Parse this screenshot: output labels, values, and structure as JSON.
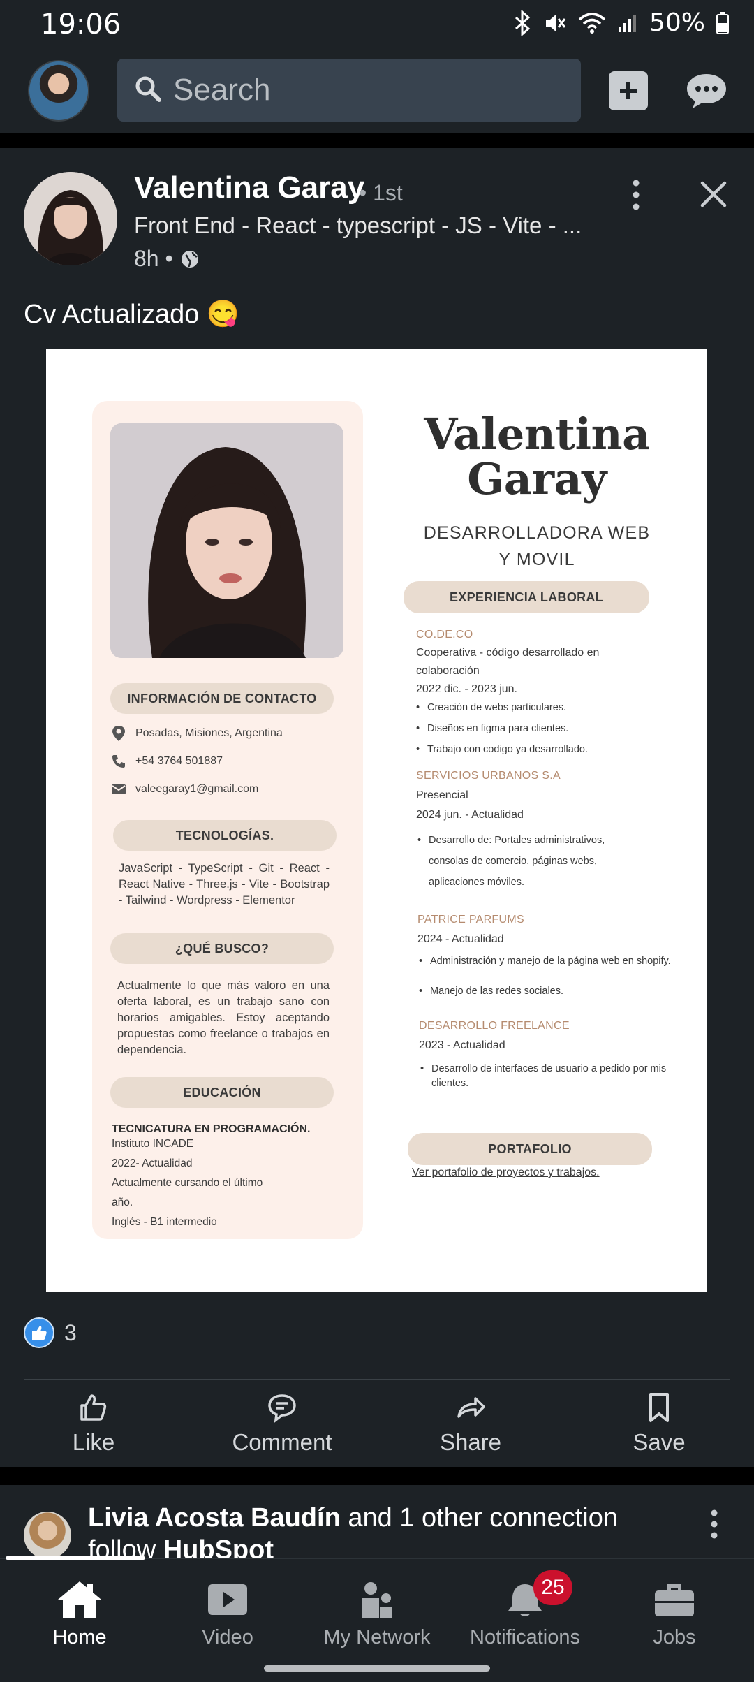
{
  "status_bar": {
    "time": "19:06",
    "battery": "50%"
  },
  "top_nav": {
    "search_placeholder": "Search"
  },
  "post": {
    "author_name": "Valentina Garay",
    "connection_degree": "• 1st",
    "headline": "Front End - React - typescript - JS - Vite - ...",
    "time": "8h •",
    "text": "Cv Actualizado 😋",
    "reaction_count": "3",
    "actions": [
      {
        "label": "Like",
        "icon": "like-icon"
      },
      {
        "label": "Comment",
        "icon": "comment-icon"
      },
      {
        "label": "Share",
        "icon": "share-icon"
      },
      {
        "label": "Save",
        "icon": "bookmark-icon"
      }
    ]
  },
  "cv": {
    "first_name": "Valentina",
    "last_name": "Garay",
    "role_line1": "DESARROLLADORA WEB",
    "role_line2": "Y MOVIL",
    "contact_header": "INFORMACIÓN DE CONTACTO",
    "location": "Posadas, Misiones, Argentina",
    "phone": "+54 3764 501887",
    "email": "valeegaray1@gmail.com",
    "tech_header": "TECNOLOGÍAS.",
    "tech_text": "JavaScript - TypeScript - Git - React - React Native - Three.js - Vite - Bootstrap - Tailwind - Wordpress - Elementor",
    "seek_header": "¿QUÉ BUSCO?",
    "seek_text": "Actualmente lo que más valoro en una oferta laboral, es un trabajo sano con horarios amigables. Estoy aceptando propuestas como freelance o trabajos en dependencia.",
    "edu_header": "EDUCACIÓN",
    "edu_title": "TECNICATURA EN PROGRAMACIÓN.",
    "edu_lines": [
      "Instituto INCADE",
      "2022- Actualidad",
      "Actualmente cursando el último",
      "año.",
      "Inglés - B1 intermedio"
    ],
    "exp_header": "EXPERIENCIA LABORAL",
    "jobs": [
      {
        "title": "CO.DE.CO",
        "lines": [
          "Cooperativa - código desarrollado en",
          "colaboración",
          "2022 dic.  -  2023 jun."
        ],
        "bullets": [
          "Creación de webs particulares.",
          "Diseños en figma para clientes.",
          " Trabajo con codigo ya desarrollado."
        ]
      },
      {
        "title": "SERVICIOS URBANOS S.A",
        "lines": [
          "Presencial",
          "2024 jun. - Actualidad"
        ],
        "bullets": [
          "Desarrollo de: Portales administrativos, consolas de comercio, páginas webs, aplicaciones móviles."
        ]
      },
      {
        "title": "PATRICE PARFUMS",
        "lines": [
          "2024 - Actualidad"
        ],
        "bullets": [
          "Administración y manejo de la página web en shopify.",
          "Manejo de las redes sociales."
        ]
      },
      {
        "title": "DESARROLLO FREELANCE",
        "lines": [
          "2023 - Actualidad"
        ],
        "bullets": [
          "Desarrollo de interfaces de usuario a pedido por mis clientes."
        ]
      }
    ],
    "portfolio_header": "PORTAFOLIO",
    "portfolio_link": "Ver portafolio de proyectos y trabajos."
  },
  "next_post": {
    "name": "Livia Acosta Baudín",
    "middle": " and 1 other connection",
    "follow": "follow ",
    "company": "HubSpot"
  },
  "bottom_nav": {
    "items": [
      {
        "label": "Home",
        "icon": "home-icon"
      },
      {
        "label": "Video",
        "icon": "video-icon"
      },
      {
        "label": "My Network",
        "icon": "network-icon"
      },
      {
        "label": "Notifications",
        "icon": "bell-icon"
      },
      {
        "label": "Jobs",
        "icon": "briefcase-icon"
      }
    ],
    "notifications_badge": "25"
  },
  "colors": {
    "background": "#1d2226",
    "accent": "#378fe9",
    "badge": "#cb112d",
    "cv_pill": "#e9dcd0"
  }
}
